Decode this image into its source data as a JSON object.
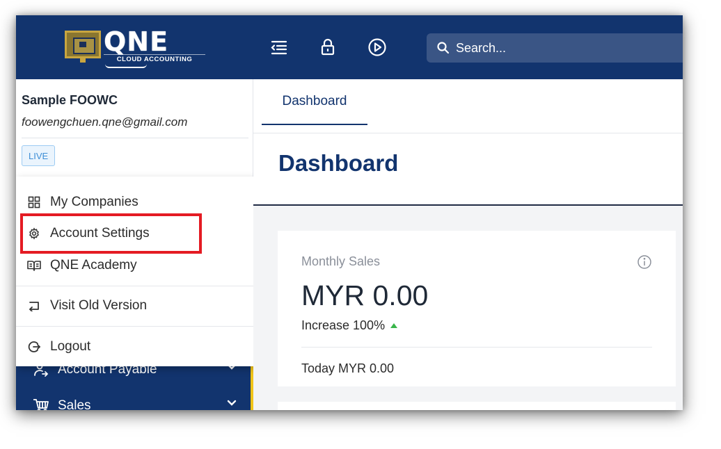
{
  "header": {
    "brand": "QNE",
    "tagline": "CLOUD ACCOUNTING",
    "icons": [
      "menu-collapse-icon",
      "lock-icon",
      "play-circle-icon"
    ],
    "search_placeholder": "Search..."
  },
  "user": {
    "company": "Sample FOOWC",
    "email": "foowengchuen.qne@gmail.com",
    "badge": "LIVE"
  },
  "dropdown": {
    "items": [
      {
        "label": "My Companies",
        "icon": "grid-icon"
      },
      {
        "label": "Account Settings",
        "icon": "gear-icon",
        "highlighted": true
      },
      {
        "label": "QNE Academy",
        "icon": "book-icon"
      },
      {
        "label": "Visit Old Version",
        "icon": "return-icon"
      },
      {
        "label": "Logout",
        "icon": "logout-icon"
      }
    ]
  },
  "sidebar": {
    "items": [
      {
        "label": "Account Payable",
        "icon": "account-payable-icon"
      },
      {
        "label": "Sales",
        "icon": "cart-icon"
      }
    ]
  },
  "main": {
    "tab": "Dashboard",
    "page_title": "Dashboard",
    "card": {
      "label": "Monthly Sales",
      "value": "MYR 0.00",
      "trend": "Increase 100%",
      "today": "Today MYR 0.00"
    }
  },
  "colors": {
    "navy": "#12346e",
    "accent_yellow": "#f0c419",
    "highlight_red": "#e41b23",
    "trend_green": "#39b54a"
  }
}
